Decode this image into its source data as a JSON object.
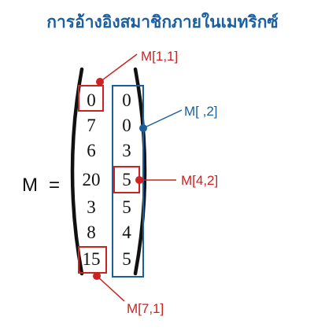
{
  "title": "การอ้างอิงสมาชิกภายในเมทริกซ์",
  "matrix_name": "M",
  "equals": "=",
  "columns": [
    [
      "0",
      "7",
      "6",
      "20",
      "3",
      "8",
      "15"
    ],
    [
      "0",
      "0",
      "3",
      "5",
      "5",
      "4",
      "5"
    ]
  ],
  "callouts": [
    {
      "label": "M[1,1]",
      "color": "#cc2222"
    },
    {
      "label": "M[ ,2]",
      "color": "#1a5f9a"
    },
    {
      "label": "M[4,2]",
      "color": "#cc2222"
    },
    {
      "label": "M[7,1]",
      "color": "#cc2222"
    }
  ],
  "colors": {
    "title": "#1a5fa0",
    "highlight_red": "#cc2222",
    "highlight_blue": "#1a5f9a",
    "text": "#111111"
  }
}
